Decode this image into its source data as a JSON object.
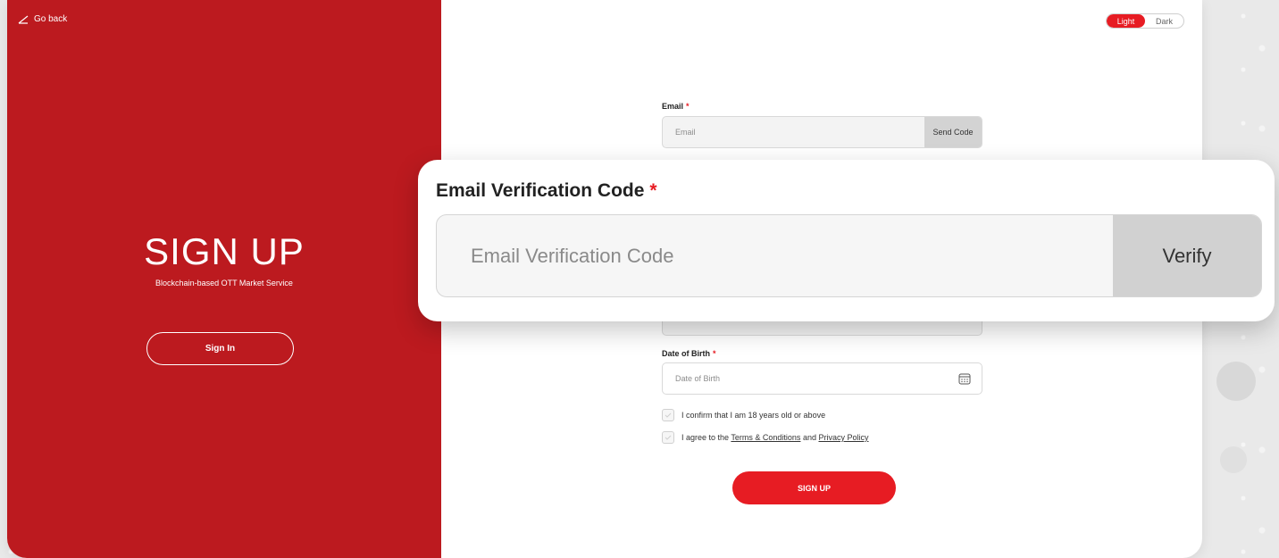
{
  "left": {
    "go_back": "Go back",
    "title": "SIGN UP",
    "subtitle": "Blockchain-based OTT Market Service",
    "sign_in": "Sign In"
  },
  "theme": {
    "light": "Light",
    "dark": "Dark"
  },
  "form": {
    "email": {
      "label": "Email",
      "required": "*",
      "placeholder": "Email",
      "button": "Send Code"
    },
    "dob": {
      "label": "Date of Birth",
      "required": "*",
      "placeholder": "Date of Birth"
    },
    "confirm_age": "I confirm that I am 18 years old or above",
    "agree": {
      "prefix": "I agree to the",
      "terms": "Terms & Conditions",
      "and": "and",
      "privacy": "Privacy Policy"
    },
    "submit": "SIGN UP"
  },
  "zoom": {
    "label": "Email Verification Code",
    "required": "*",
    "placeholder": "Email Verification Code",
    "button": "Verify"
  },
  "colors": {
    "brand_red": "#e71c23",
    "panel_red": "#bc1a1f"
  }
}
